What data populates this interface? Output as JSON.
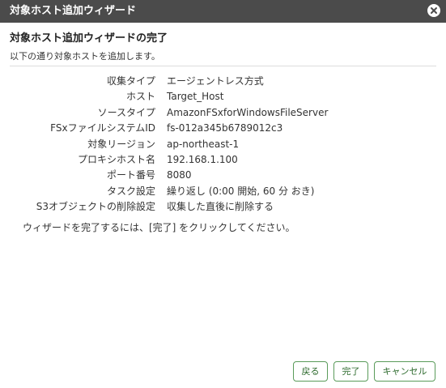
{
  "window": {
    "title": "対象ホスト追加ウィザード",
    "close_icon": "close-circle-icon"
  },
  "main": {
    "heading": "対象ホスト追加ウィザードの完了",
    "description": "以下の通り対象ホストを追加します。",
    "summary": [
      {
        "label": "収集タイプ",
        "value": "エージェントレス方式"
      },
      {
        "label": "ホスト",
        "value": "Target_Host"
      },
      {
        "label": "ソースタイプ",
        "value": "AmazonFSxforWindowsFileServer"
      },
      {
        "label": "FSxファイルシステムID",
        "value": "fs-012a345b6789012c3"
      },
      {
        "label": "対象リージョン",
        "value": "ap-northeast-1"
      },
      {
        "label": "プロキシホスト名",
        "value": "192.168.1.100"
      },
      {
        "label": "ポート番号",
        "value": "8080"
      },
      {
        "label": "タスク設定",
        "value": "繰り返し (0:00 開始, 60 分 おき)"
      },
      {
        "label": "S3オブジェクトの削除設定",
        "value": "収集した直後に削除する"
      }
    ],
    "instruction": "ウィザードを完了するには、[完了] をクリックしてください。"
  },
  "footer": {
    "back_label": "戻る",
    "finish_label": "完了",
    "cancel_label": "キャンセル"
  },
  "colors": {
    "titlebar_bg": "#4b4b4b",
    "button_border": "#5a9b5a",
    "button_text": "#2e6b2e"
  }
}
